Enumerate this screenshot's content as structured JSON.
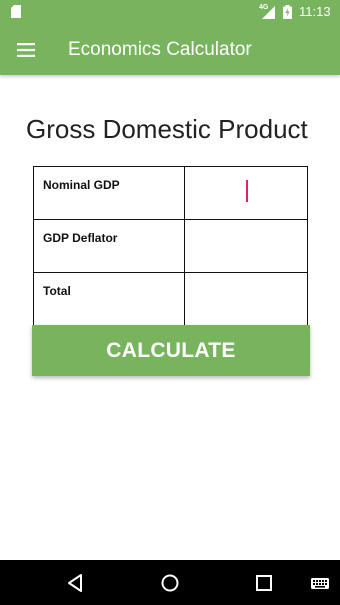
{
  "status_bar": {
    "network": "4G",
    "time": "11:13"
  },
  "app_bar": {
    "title": "Economics Calculator",
    "menu_icon": "hamburger-menu-icon"
  },
  "page": {
    "title": "Gross Domestic Product"
  },
  "form": {
    "rows": [
      {
        "label": "Nominal GDP",
        "value": ""
      },
      {
        "label": "GDP Deflator",
        "value": ""
      },
      {
        "label": "Total",
        "value": ""
      }
    ],
    "calculate_label": "CALCULATE"
  },
  "nav_bar": {
    "icons": [
      "back-icon",
      "home-icon",
      "recents-icon",
      "keyboard-icon"
    ]
  },
  "colors": {
    "accent": "#78b45e",
    "cursor": "#e91e63",
    "nav_background": "#000000"
  }
}
